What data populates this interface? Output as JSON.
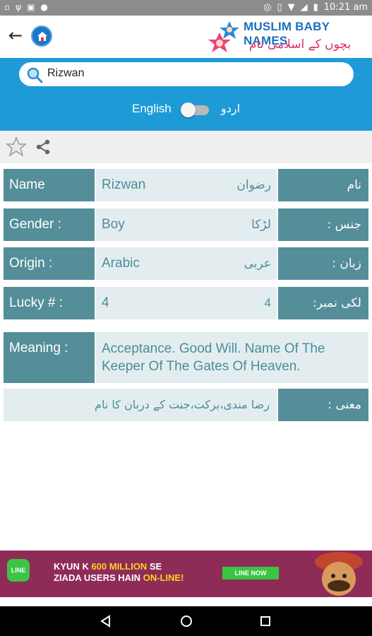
{
  "status_bar": {
    "time": "10:21 am"
  },
  "app_bar": {
    "logo_title": "MUSLIM BABY NAMES",
    "logo_subtitle": "بچوں کے اسلامی نام"
  },
  "search": {
    "value": "Rizwan"
  },
  "language": {
    "english": "English",
    "urdu": "اردو",
    "toggle_on": false
  },
  "details": {
    "name": {
      "label_en": "Name",
      "value_en": "Rizwan",
      "value_ur": "رضوان",
      "label_ur": "نام"
    },
    "gender": {
      "label_en": "Gender :",
      "value_en": "Boy",
      "value_ur": "لڑکا",
      "label_ur": "جنس :"
    },
    "origin": {
      "label_en": "Origin :",
      "value_en": "Arabic",
      "value_ur": "عربی",
      "label_ur": "زبان :"
    },
    "lucky": {
      "label_en": "Lucky # :",
      "value_en": "4",
      "value_ur": "4",
      "label_ur": "لکی نمبر:"
    },
    "meaning": {
      "label_en": "Meaning :",
      "value_en": "Acceptance. Good Will. Name Of The Keeper Of The Gates Of Heaven."
    },
    "mani": {
      "value_ur": "رضا مندی،برکت،جنت کے دربان کا نام",
      "label_ur": "معنی :"
    }
  },
  "ad": {
    "logo": "LINE",
    "line1_a": "KYUN K ",
    "line1_hl": "600 MILLION",
    "line1_b": " SE",
    "line2_a": "ZIADA USERS HAIN ",
    "line2_hl": "ON-LINE!",
    "button": "LINE NOW"
  },
  "colors": {
    "accent": "#1e9bd7",
    "label_bg": "#548e99",
    "value_bg": "#e3edf0",
    "ad_bg": "#8e2c57"
  }
}
